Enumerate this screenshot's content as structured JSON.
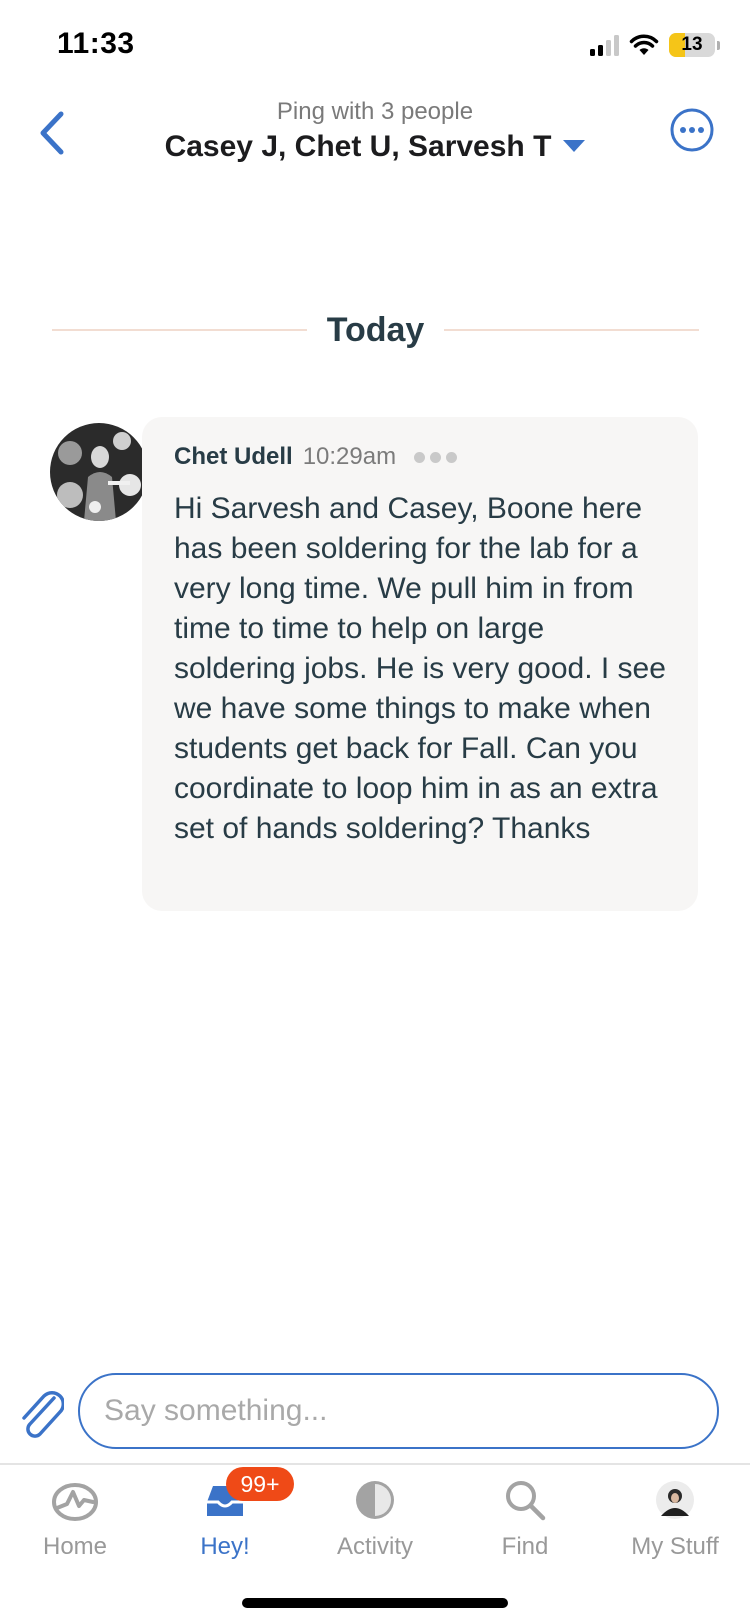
{
  "status_bar": {
    "time": "11:33",
    "battery": "13",
    "battery_level": 0.13
  },
  "header": {
    "subtitle": "Ping with 3 people",
    "title": "Casey J, Chet U, Sarvesh T"
  },
  "divider": {
    "label": "Today"
  },
  "message": {
    "author": "Chet Udell",
    "time": "10:29am",
    "body": "Hi Sarvesh and Casey, Boone here has been soldering for the lab for a very long time. We pull him in from time to time to help on large soldering jobs. He is very good. I see we have some things to make when students get back for Fall. Can you coordinate to loop him in as an extra set of hands soldering? Thanks"
  },
  "composer": {
    "placeholder": "Say something..."
  },
  "tabs": [
    {
      "label": "Home",
      "icon": "home-pulse-icon"
    },
    {
      "label": "Hey!",
      "icon": "inbox-icon",
      "badge": "99+"
    },
    {
      "label": "Activity",
      "icon": "pie-icon"
    },
    {
      "label": "Find",
      "icon": "search-icon"
    },
    {
      "label": "My Stuff",
      "icon": "avatar"
    }
  ],
  "colors": {
    "accent": "#3b73c8",
    "badge": "#ef4a17",
    "bubble": "#f7f6f5",
    "text": "#283c46"
  }
}
